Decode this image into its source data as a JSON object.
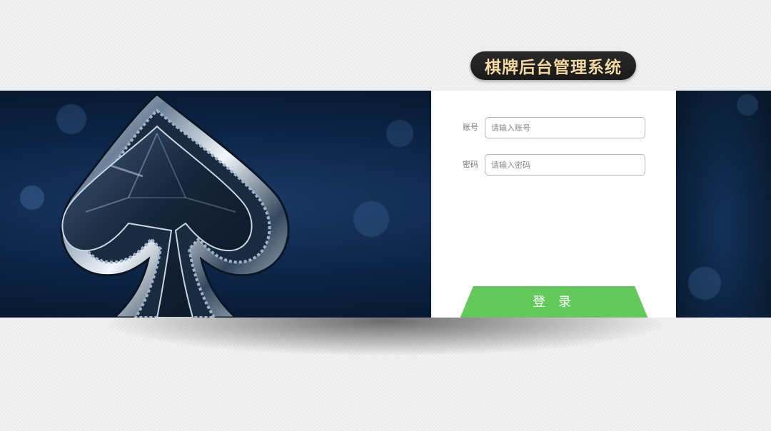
{
  "header": {
    "title": "棋牌后台管理系统"
  },
  "login_form": {
    "account_label": "账号",
    "account_placeholder": "请输入账号",
    "account_value": "",
    "password_label": "密码",
    "password_placeholder": "请输入密码",
    "password_value": "",
    "submit_label": "登 录"
  },
  "banner": {
    "image": "spade-icon"
  },
  "colors": {
    "title_background": "#1f1f1f",
    "title_text": "#f4d9a2",
    "login_button": "#63c95d",
    "banner_dark": "#05101f",
    "banner_light": "#1b3a66"
  }
}
